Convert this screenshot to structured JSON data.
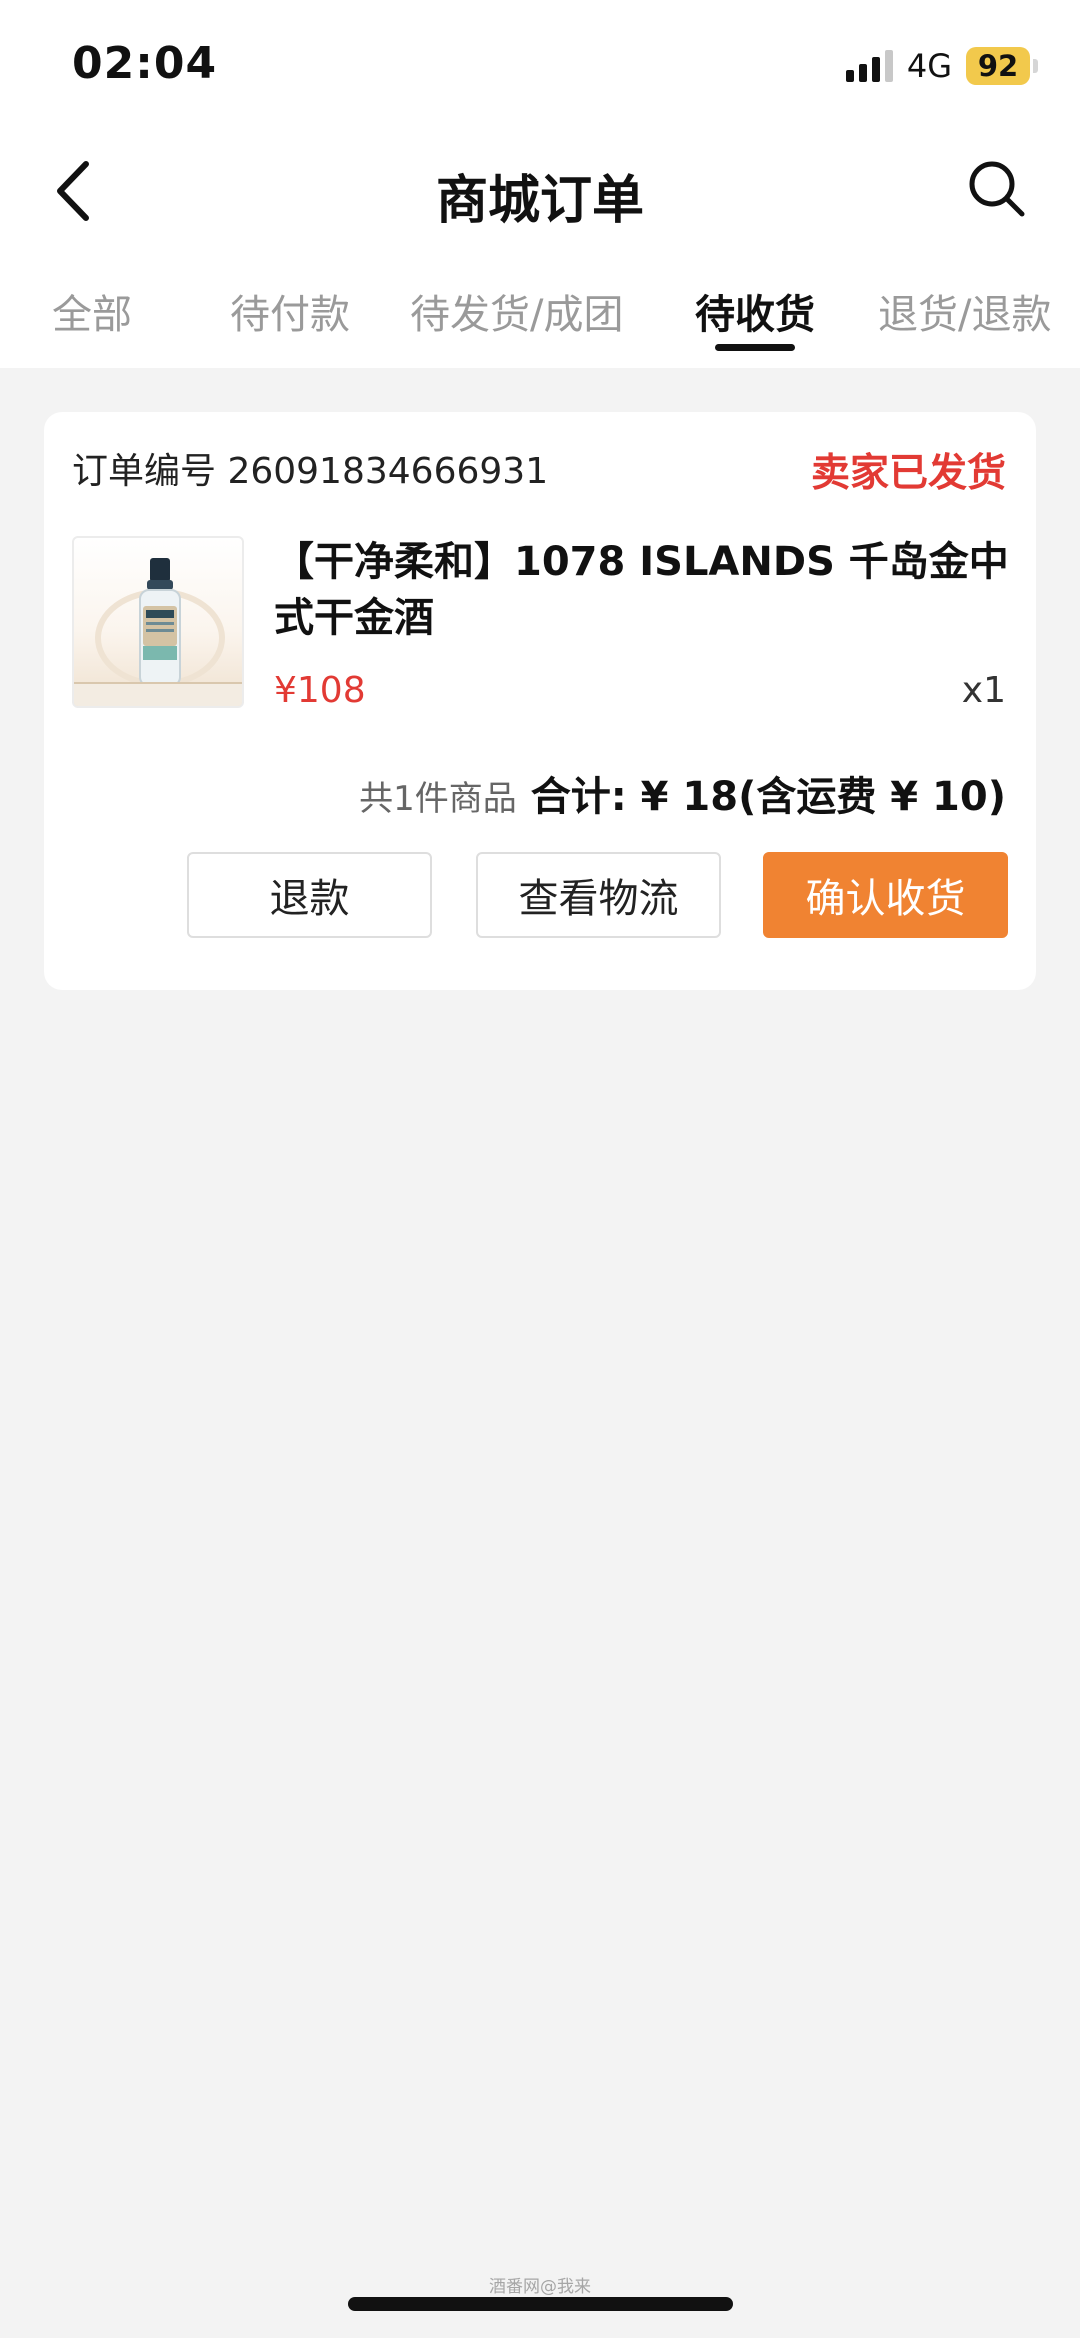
{
  "status_bar": {
    "time": "02:04",
    "network": "4G",
    "battery": "92",
    "battery_color": "#f2c94c"
  },
  "header": {
    "title": "商城订单",
    "back_icon": "chevron-left-icon",
    "search_icon": "search-icon"
  },
  "tabs": [
    {
      "label": "全部",
      "active": false
    },
    {
      "label": "待付款",
      "active": false
    },
    {
      "label": "待发货/成团",
      "active": false
    },
    {
      "label": "待收货",
      "active": true
    },
    {
      "label": "退货/退款",
      "active": false
    }
  ],
  "order": {
    "order_no_label": "订单编号 26091834666931",
    "status": "卖家已发货",
    "product": {
      "name": "【干净柔和】1078 ISLANDS 千岛金中式干金酒",
      "price": "¥108",
      "qty": "x1"
    },
    "summary": {
      "count": "共1件商品",
      "total": "合计: ¥ 18(含运费 ¥ 10)"
    },
    "actions": {
      "refund": "退款",
      "logistics": "查看物流",
      "confirm": "确认收货"
    }
  },
  "colors": {
    "accent_orange": "#f08332",
    "status_red": "#e23a34",
    "background": "#f3f3f3"
  },
  "watermark": "酒番网@我来"
}
